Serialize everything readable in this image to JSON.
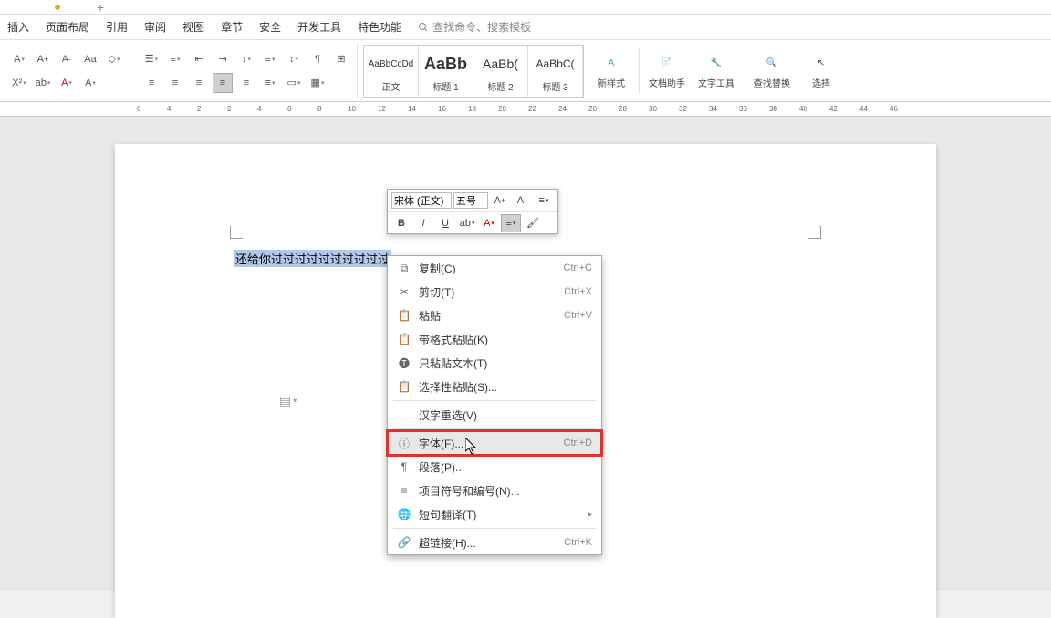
{
  "tab": {
    "plus": "+"
  },
  "menu": {
    "items": [
      "插入",
      "页面布局",
      "引用",
      "审阅",
      "视图",
      "章节",
      "安全",
      "开发工具",
      "特色功能"
    ],
    "search_placeholder": "查找命令、搜索模板"
  },
  "ribbon": {
    "styles": [
      {
        "preview": "AaBbCcDd",
        "label": "正文"
      },
      {
        "preview": "AaBb",
        "label": "标题 1"
      },
      {
        "preview": "AaBb(",
        "label": "标题 2"
      },
      {
        "preview": "AaBbC(",
        "label": "标题 3"
      }
    ],
    "big_buttons": {
      "new_style": "新样式",
      "doc_assist": "文档助手",
      "text_tool": "文字工具",
      "find_replace": "查找替换",
      "select": "选择"
    }
  },
  "ruler_ticks": [
    "6",
    "4",
    "2",
    "2",
    "4",
    "6",
    "8",
    "10",
    "12",
    "14",
    "16",
    "18",
    "20",
    "22",
    "24",
    "26",
    "28",
    "30",
    "32",
    "34",
    "36",
    "38",
    "40",
    "42",
    "44",
    "46"
  ],
  "document": {
    "selected_text": "还给你过过过过过过过过过过"
  },
  "float_toolbar": {
    "font": "宋体 (正文)",
    "size": "五号"
  },
  "context_menu": {
    "items": [
      {
        "icon": "copy",
        "label": "复制(C)",
        "key": "Ctrl+C"
      },
      {
        "icon": "cut",
        "label": "剪切(T)",
        "key": "Ctrl+X"
      },
      {
        "icon": "paste",
        "label": "粘贴",
        "key": "Ctrl+V"
      },
      {
        "icon": "paste-fmt",
        "label": "带格式粘贴(K)"
      },
      {
        "icon": "paste-text",
        "label": "只粘贴文本(T)"
      },
      {
        "icon": "paste-sel",
        "label": "选择性粘贴(S)..."
      },
      {
        "sep": true
      },
      {
        "label": "汉字重选(V)"
      },
      {
        "sep": true
      },
      {
        "icon": "font",
        "label": "字体(F)...",
        "key": "Ctrl+D",
        "highlight": true,
        "hovered": true
      },
      {
        "icon": "para",
        "label": "段落(P)..."
      },
      {
        "icon": "bullets",
        "label": "项目符号和编号(N)..."
      },
      {
        "icon": "translate",
        "label": "短句翻译(T)",
        "arrow": true
      },
      {
        "sep": true
      },
      {
        "icon": "link",
        "label": "超链接(H)...",
        "key": "Ctrl+K"
      }
    ]
  }
}
